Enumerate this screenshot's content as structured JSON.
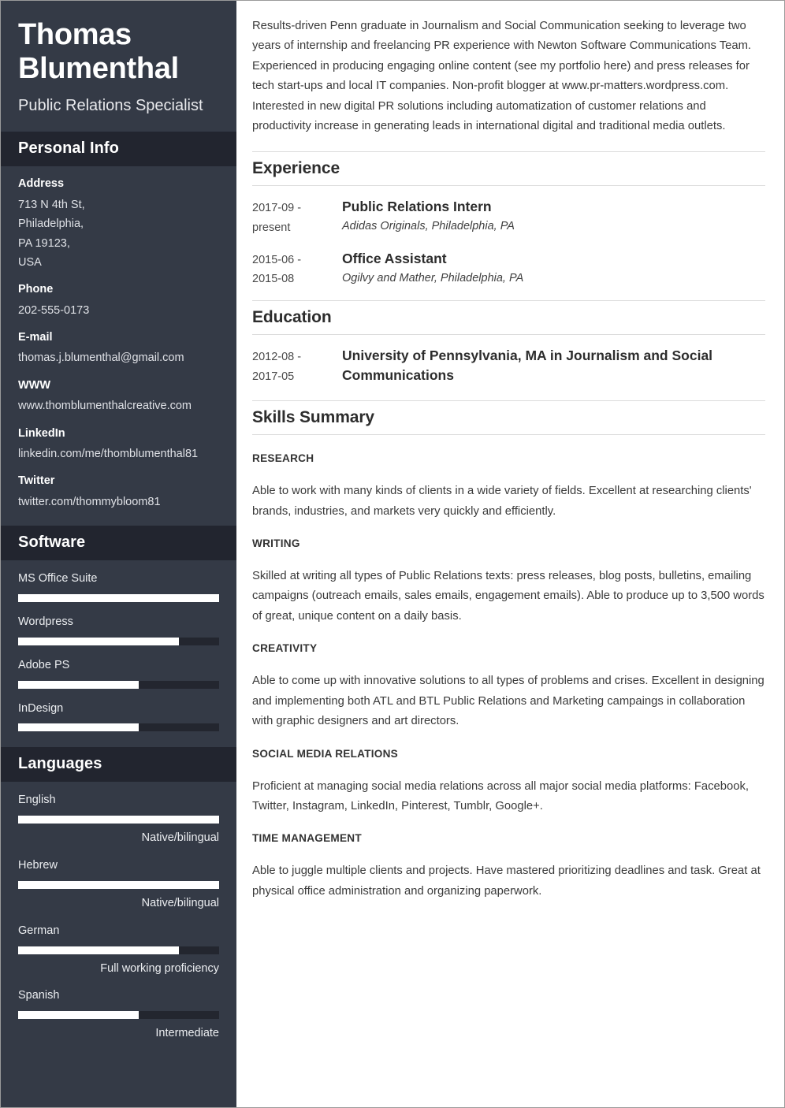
{
  "header": {
    "full_name": "Thomas Blumenthal",
    "job_title": "Public Relations Specialist"
  },
  "sidebar": {
    "personal_info": {
      "heading": "Personal Info",
      "items": [
        {
          "label": "Address",
          "lines": [
            "713 N 4th St,",
            "Philadelphia,",
            "PA 19123,",
            "USA"
          ]
        },
        {
          "label": "Phone",
          "lines": [
            "202-555-0173"
          ]
        },
        {
          "label": "E-mail",
          "lines": [
            "thomas.j.blumenthal@gmail.com"
          ]
        },
        {
          "label": "WWW",
          "lines": [
            "www.thomblumenthalcreative.com"
          ]
        },
        {
          "label": "LinkedIn",
          "lines": [
            "linkedin.com/me/thomblumenthal81"
          ]
        },
        {
          "label": "Twitter",
          "lines": [
            "twitter.com/thommybloom81"
          ]
        }
      ]
    },
    "software": {
      "heading": "Software",
      "items": [
        {
          "name": "MS Office Suite",
          "percent": 100
        },
        {
          "name": "Wordpress",
          "percent": 80
        },
        {
          "name": "Adobe PS",
          "percent": 60
        },
        {
          "name": "InDesign",
          "percent": 60
        }
      ]
    },
    "languages": {
      "heading": "Languages",
      "items": [
        {
          "name": "English",
          "percent": 100,
          "level": "Native/bilingual"
        },
        {
          "name": "Hebrew",
          "percent": 100,
          "level": "Native/bilingual"
        },
        {
          "name": "German",
          "percent": 80,
          "level": "Full working proficiency"
        },
        {
          "name": "Spanish",
          "percent": 60,
          "level": "Intermediate"
        }
      ]
    }
  },
  "main": {
    "summary": "Results-driven Penn graduate in Journalism and Social Communication seeking to leverage two years of internship and freelancing PR experience with Newton Software Communications Team. Experienced in producing engaging online content (see my portfolio here) and press releases for tech start-ups and local IT companies. Non-profit blogger at www.pr-matters.wordpress.com. Interested in new digital PR solutions including automatization of customer relations and productivity increase in generating leads in international digital and traditional media outlets.",
    "experience": {
      "heading": "Experience",
      "entries": [
        {
          "date_lines": [
            "2017-09 -",
            "present"
          ],
          "role": "Public Relations Intern",
          "org": "Adidas Originals, Philadelphia, PA"
        },
        {
          "date_lines": [
            "2015-06 -",
            "2015-08"
          ],
          "role": "Office Assistant",
          "org": "Ogilvy and Mather, Philadelphia, PA"
        }
      ]
    },
    "education": {
      "heading": "Education",
      "entries": [
        {
          "date_lines": [
            "2012-08 -",
            "2017-05"
          ],
          "role": "University of Pennsylvania, MA in Journalism and Social Communications",
          "org": ""
        }
      ]
    },
    "skills_summary": {
      "heading": "Skills Summary",
      "blocks": [
        {
          "title": "RESEARCH",
          "description": "Able to work with many kinds of clients in a wide variety of fields. Excellent at researching clients' brands, industries, and markets very quickly and efficiently."
        },
        {
          "title": "WRITING",
          "description": "Skilled at writing all types of Public Relations texts: press releases, blog posts, bulletins, emailing campaigns (outreach emails, sales emails, engagement emails). Able to produce up to 3,500 words of great, unique content on a daily basis."
        },
        {
          "title": "CREATIVITY",
          "description": "Able to come up with innovative solutions to all types of problems and crises. Excellent in designing and implementing both ATL and BTL Public Relations and Marketing campaings in collaboration with graphic designers and art directors."
        },
        {
          "title": "SOCIAL MEDIA RELATIONS",
          "description": "Proficient at managing social media relations across all major social media platforms: Facebook, Twitter, Instagram, LinkedIn, Pinterest, Tumblr, Google+."
        },
        {
          "title": "TIME MANAGEMENT",
          "description": "Able to juggle multiple clients and projects. Have mastered prioritizing deadlines and task. Great at physical office administration and organizing paperwork."
        }
      ]
    }
  },
  "colors": {
    "sidebar_bg": "#343a46",
    "sidebar_head_bg": "#22252f",
    "bar_fill": "#ffffff",
    "bar_track": "#23262f",
    "rule": "#dcdcdc"
  }
}
